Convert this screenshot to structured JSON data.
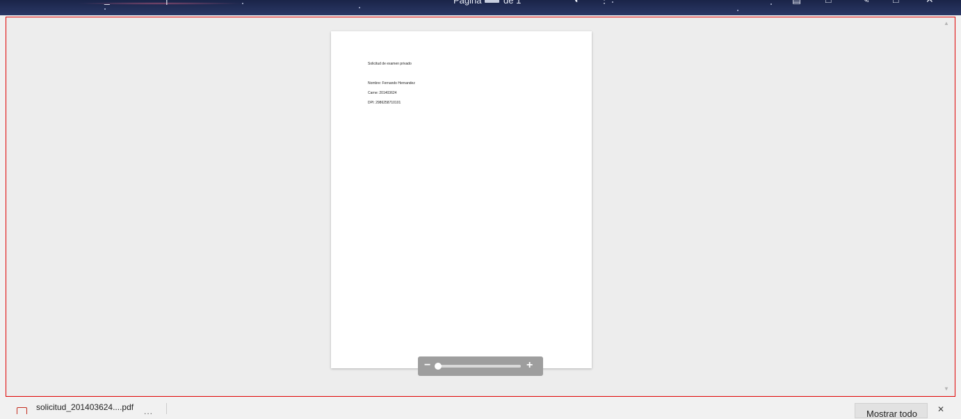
{
  "toolbar": {
    "page_label": "Página",
    "page_total": "de 1",
    "icons": [
      "menu-icon",
      "contents-icon",
      "night-mode-icon",
      "options-icon",
      "print-icon",
      "save-icon",
      "draw-icon",
      "fullscreen-icon",
      "close-icon"
    ]
  },
  "document": {
    "lines": [
      "Solicitud de examen privado",
      "Nombre: Fernando Hernandez",
      "Carne: 201403624",
      "DPI: 2986258710101"
    ]
  },
  "zoom": {
    "minus": "−",
    "plus": "+",
    "level": 0.03
  },
  "downloads": {
    "file_name": "solicitud_201403624....pdf",
    "more": "...",
    "show_all": "Mostrar todo",
    "close": "✕"
  },
  "colors": {
    "highlight_border": "#e00000",
    "pdf_icon": "#c42b1c",
    "toolbar_bg": "#24305a"
  }
}
